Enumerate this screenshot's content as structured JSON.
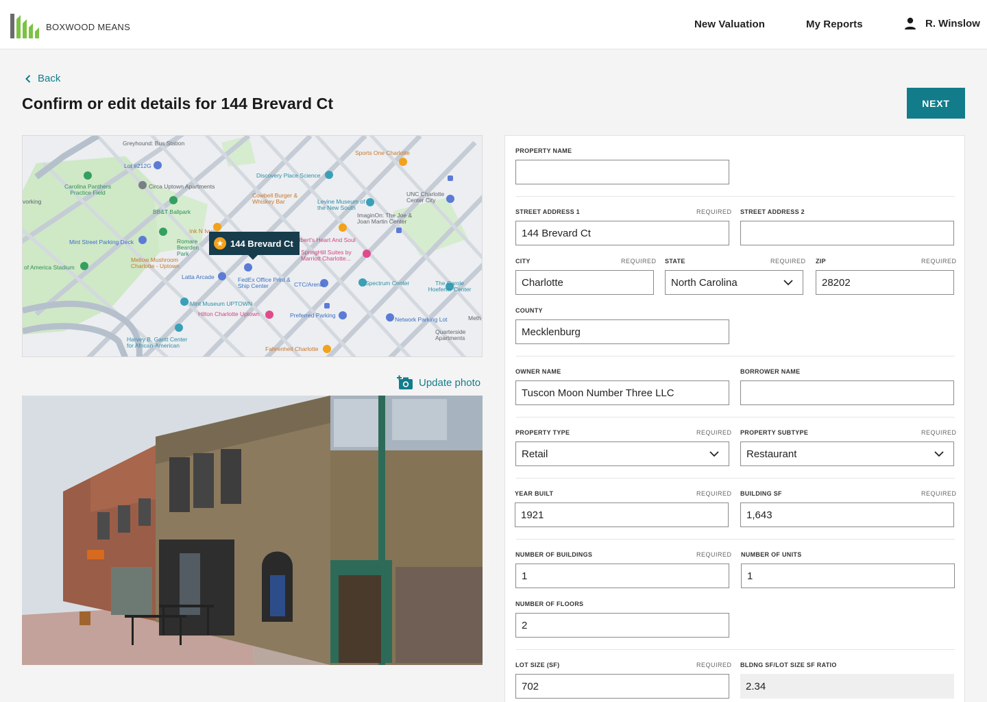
{
  "brand": {
    "name": "BOXWOOD MEANS",
    "accent": "#127c8a",
    "logo_green": "#7cc243",
    "logo_gray": "#6b6b6b"
  },
  "nav": {
    "new_valuation": "New Valuation",
    "my_reports": "My Reports",
    "user_name": "R. Winslow"
  },
  "page": {
    "back_label": "Back",
    "title": "Confirm or edit details for 144 Brevard Ct",
    "next_label": "NEXT",
    "update_photo_label": "Update photo"
  },
  "map": {
    "pin_label": "144 Brevard Ct",
    "labels": [
      "Greyhound: Bus Station",
      "Lot #212G",
      "Carolina Panthers Practice Field",
      "Circa Uptown Apartments",
      "BB&T Ballpark",
      "Mint Street Parking Deck",
      "Romare Bearden Park",
      "Mellow Mushroom Charlotte - Uptown",
      "of America Stadium",
      "Latta Arcade",
      "FedEx Office Print & Ship Center",
      "CTC/Arena",
      "Mint Museum UPTOWN",
      "Hilton Charlotte Uptown",
      "Preferred Parking",
      "Harvey B. Gantt Center for African-American",
      "Fahrenheit Charlotte",
      "Discovery Place Science",
      "Cowbell Burger & Whiskey Bar",
      "Levine Museum of the New South",
      "Sports One Charlotte",
      "UNC Charlotte Center City",
      "ImaginOn: The Joe & Joan Martin Center",
      "Ink N Ivy",
      "Albert's Heart And Soul",
      "SpringHill Suites by Marriott Charlotte...",
      "Spectrum Center",
      "The Carole Hoefener Center",
      "Network Parking Lot",
      "Quarterside Apartments",
      "Meth",
      "vorking"
    ]
  },
  "form": {
    "property_name": {
      "label": "PROPERTY NAME",
      "value": ""
    },
    "street_address_1": {
      "label": "STREET ADDRESS 1",
      "required": "REQUIRED",
      "value": "144 Brevard Ct"
    },
    "street_address_2": {
      "label": "STREET ADDRESS 2",
      "value": ""
    },
    "city": {
      "label": "CITY",
      "required": "REQUIRED",
      "value": "Charlotte"
    },
    "state": {
      "label": "STATE",
      "required": "REQUIRED",
      "value": "North Carolina"
    },
    "zip": {
      "label": "ZIP",
      "required": "REQUIRED",
      "value": "28202"
    },
    "county": {
      "label": "COUNTY",
      "value": "Mecklenburg"
    },
    "owner_name": {
      "label": "OWNER NAME",
      "value": "Tuscon Moon Number Three LLC"
    },
    "borrower_name": {
      "label": "BORROWER NAME",
      "value": ""
    },
    "property_type": {
      "label": "PROPERTY TYPE",
      "required": "REQUIRED",
      "value": "Retail"
    },
    "property_subtype": {
      "label": "PROPERTY SUBTYPE",
      "required": "REQUIRED",
      "value": "Restaurant"
    },
    "year_built": {
      "label": "YEAR BUILT",
      "required": "REQUIRED",
      "value": "1921"
    },
    "building_sf": {
      "label": "BUILDING SF",
      "required": "REQUIRED",
      "value": "1,643"
    },
    "number_of_buildings": {
      "label": "NUMBER OF BUILDINGS",
      "required": "REQUIRED",
      "value": "1"
    },
    "number_of_units": {
      "label": "NUMBER OF UNITS",
      "value": "1"
    },
    "number_of_floors": {
      "label": "NUMBER OF FLOORS",
      "value": "2"
    },
    "lot_size": {
      "label": "LOT SIZE (SF)",
      "required": "REQUIRED",
      "value": "702"
    },
    "ratio": {
      "label": "BLDNG SF/LOT SIZE SF RATIO",
      "value": "2.34"
    }
  }
}
